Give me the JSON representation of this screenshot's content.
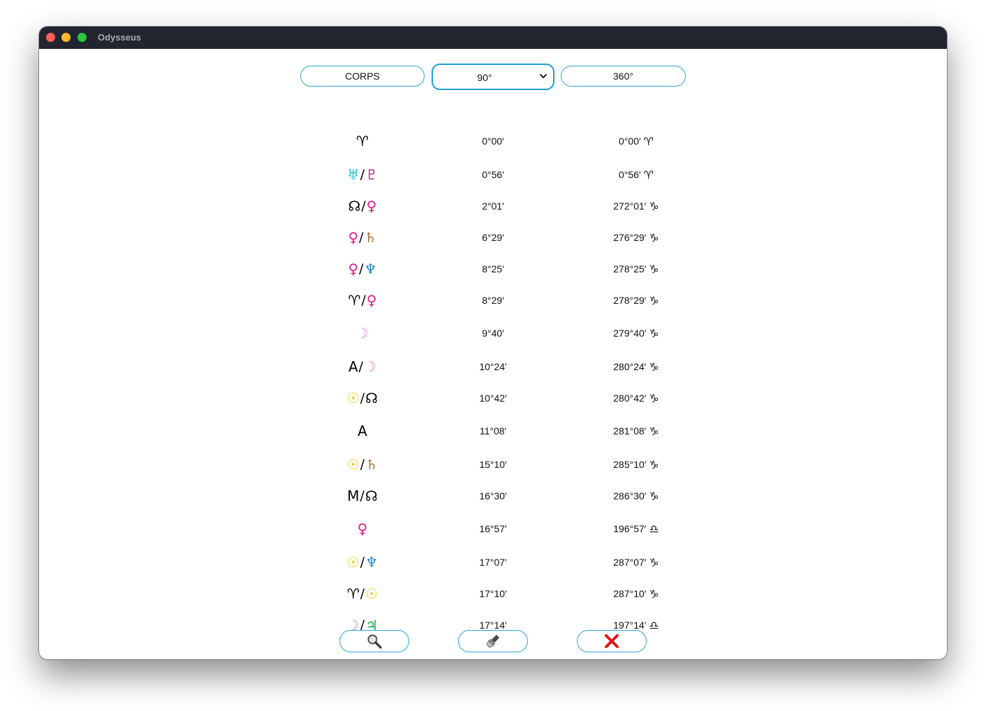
{
  "window": {
    "title": "Odysseus"
  },
  "header": {
    "left_button": "CORPS",
    "select_value": "90°",
    "right_button": "360°"
  },
  "colors": {
    "accent_border": "#2aa5d8",
    "titlebar": "#222530",
    "uranus": "#1fc8d4",
    "pluto": "#b0208f",
    "venus": "#e8168c",
    "saturn": "#a8703a",
    "neptune": "#1d84d6",
    "moon": "#d985d8",
    "sun": "#f2c400",
    "jupiter": "#17a84a",
    "close_x": "#e01515"
  },
  "rows": [
    {
      "symbols": [
        {
          "glyph": "♈",
          "color": "#000000"
        }
      ],
      "value90": "0°00′",
      "value360": "0°00′",
      "sign": "♈"
    },
    {
      "symbols": [
        {
          "glyph": "♅",
          "color": "#1fc8d4"
        },
        {
          "glyph": "♇",
          "color": "#b0208f"
        }
      ],
      "value90": "0°56′",
      "value360": "0°56′",
      "sign": "♈"
    },
    {
      "symbols": [
        {
          "glyph": "☊",
          "color": "#000000"
        },
        {
          "glyph": "♀",
          "color": "#e8168c"
        }
      ],
      "value90": "2°01′",
      "value360": "272°01′",
      "sign": "♑"
    },
    {
      "symbols": [
        {
          "glyph": "♀",
          "color": "#e8168c"
        },
        {
          "glyph": "♄",
          "color": "#a8703a"
        }
      ],
      "value90": "6°29′",
      "value360": "276°29′",
      "sign": "♑"
    },
    {
      "symbols": [
        {
          "glyph": "♀",
          "color": "#e8168c"
        },
        {
          "glyph": "♆",
          "color": "#1d84d6"
        }
      ],
      "value90": "8°25′",
      "value360": "278°25′",
      "sign": "♑"
    },
    {
      "symbols": [
        {
          "glyph": "♈",
          "color": "#000000"
        },
        {
          "glyph": "♀",
          "color": "#e8168c"
        }
      ],
      "value90": "8°29′",
      "value360": "278°29′",
      "sign": "♑"
    },
    {
      "symbols": [
        {
          "glyph": "☽",
          "color": "#d985d8"
        }
      ],
      "value90": "9°40′",
      "value360": "279°40′",
      "sign": "♑"
    },
    {
      "symbols": [
        {
          "glyph": "A",
          "color": "#000000"
        },
        {
          "glyph": "☽",
          "color": "#d985d8"
        }
      ],
      "value90": "10°24′",
      "value360": "280°24′",
      "sign": "♑"
    },
    {
      "symbols": [
        {
          "glyph": "☉",
          "color": "#f2c400"
        },
        {
          "glyph": "☊",
          "color": "#000000"
        }
      ],
      "value90": "10°42′",
      "value360": "280°42′",
      "sign": "♑"
    },
    {
      "symbols": [
        {
          "glyph": "A",
          "color": "#000000"
        }
      ],
      "value90": "11°08′",
      "value360": "281°08′",
      "sign": "♑"
    },
    {
      "symbols": [
        {
          "glyph": "☉",
          "color": "#f2c400"
        },
        {
          "glyph": "♄",
          "color": "#a8703a"
        }
      ],
      "value90": "15°10′",
      "value360": "285°10′",
      "sign": "♑"
    },
    {
      "symbols": [
        {
          "glyph": "M",
          "color": "#000000"
        },
        {
          "glyph": "☊",
          "color": "#000000"
        }
      ],
      "value90": "16°30′",
      "value360": "286°30′",
      "sign": "♑"
    },
    {
      "symbols": [
        {
          "glyph": "♀",
          "color": "#e8168c"
        }
      ],
      "value90": "16°57′",
      "value360": "196°57′",
      "sign": "♎"
    },
    {
      "symbols": [
        {
          "glyph": "☉",
          "color": "#f2c400"
        },
        {
          "glyph": "♆",
          "color": "#1d84d6"
        }
      ],
      "value90": "17°07′",
      "value360": "287°07′",
      "sign": "♑"
    },
    {
      "symbols": [
        {
          "glyph": "♈",
          "color": "#000000"
        },
        {
          "glyph": "☉",
          "color": "#f2c400"
        }
      ],
      "value90": "17°10′",
      "value360": "287°10′",
      "sign": "♑"
    },
    {
      "symbols": [
        {
          "glyph": "☽",
          "color": "#d985d8"
        },
        {
          "glyph": "♃",
          "color": "#17a84a"
        }
      ],
      "value90": "17°14′",
      "value360": "197°14′",
      "sign": "♎"
    }
  ],
  "footer": {
    "icons": [
      "magnifier-icon",
      "flashlight-icon",
      "close-x-icon"
    ]
  }
}
